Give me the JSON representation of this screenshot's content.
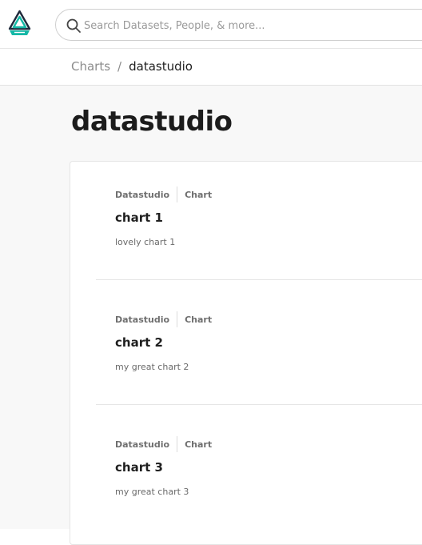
{
  "header": {
    "logo": "datopian-logo",
    "search": {
      "placeholder": "Search Datasets, People, & more...",
      "value": "",
      "icon": "search-icon"
    }
  },
  "breadcrumb": {
    "parent": "Charts",
    "separator": "/",
    "current": "datastudio"
  },
  "page": {
    "title": "datastudio"
  },
  "items": [
    {
      "tag1": "Datastudio",
      "tag2": "Chart",
      "title": "chart 1",
      "description": "lovely chart 1"
    },
    {
      "tag1": "Datastudio",
      "tag2": "Chart",
      "title": "chart 2",
      "description": "my great chart 2"
    },
    {
      "tag1": "Datastudio",
      "tag2": "Chart",
      "title": "chart 3",
      "description": "my great chart 3"
    }
  ],
  "colors": {
    "logo_teal": "#14b8a6",
    "logo_dark": "#1e293b"
  }
}
